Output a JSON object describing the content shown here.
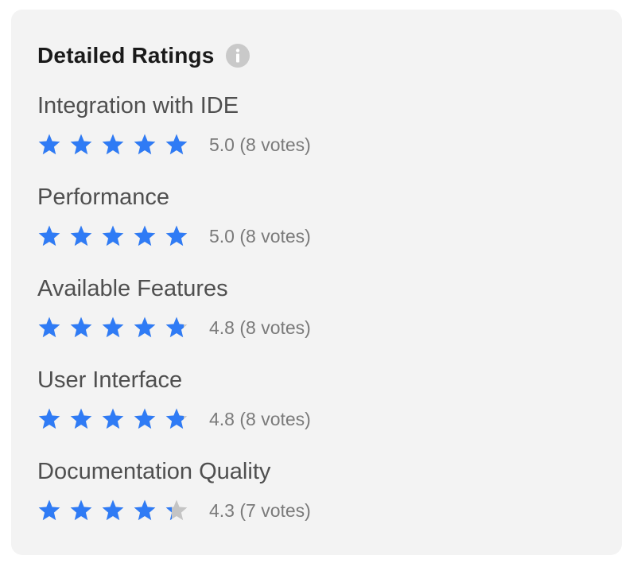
{
  "card": {
    "title": "Detailed Ratings",
    "info_icon": "info-icon"
  },
  "colors": {
    "star_filled": "#2f7bf5",
    "star_empty": "#c4c4c4",
    "card_background": "#f3f3f3"
  },
  "star_max": 5,
  "ratings": [
    {
      "label": "Integration with IDE",
      "score": 5.0,
      "score_text": "5.0 (8 votes)"
    },
    {
      "label": "Performance",
      "score": 5.0,
      "score_text": "5.0 (8 votes)"
    },
    {
      "label": "Available Features",
      "score": 4.8,
      "score_text": "4.8 (8 votes)"
    },
    {
      "label": "User Interface",
      "score": 4.8,
      "score_text": "4.8 (8 votes)"
    },
    {
      "label": "Documentation Quality",
      "score": 4.3,
      "score_text": "4.3 (7 votes)"
    }
  ]
}
